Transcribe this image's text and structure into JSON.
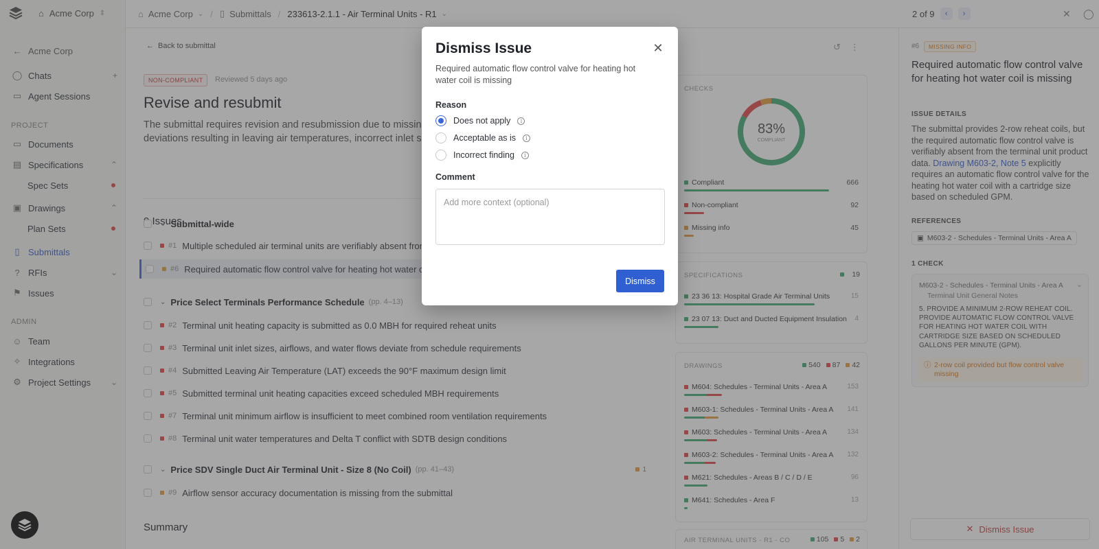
{
  "sidebar": {
    "org": "Acme Corp",
    "back_label": "Acme Corp",
    "chats": "Chats",
    "agent_sessions": "Agent Sessions",
    "project_section": "PROJECT",
    "documents": "Documents",
    "specifications": "Specifications",
    "spec_sets": "Spec Sets",
    "drawings": "Drawings",
    "plan_sets": "Plan Sets",
    "submittals": "Submittals",
    "rfis": "RFIs",
    "issues": "Issues",
    "admin_section": "ADMIN",
    "team": "Team",
    "integrations": "Integrations",
    "project_settings": "Project Settings"
  },
  "topbar": {
    "org": "Acme Corp",
    "submittals": "Submittals",
    "current": "233613-2.1.1 - Air Terminal Units - R1",
    "pager": "2 of 9"
  },
  "main": {
    "back": "Back to submittal",
    "status_badge": "NON-COMPLIANT",
    "reviewed": "Reviewed 5 days ago",
    "title": "Revise and resubmit",
    "summary": "The submittal requires revision and resubmission due to missing terminal units, widespread heating capacity deviations resulting in leaving air temperatures, incorrect inlet sizes, and missing flow",
    "issues_count": "9 Issues",
    "groups": {
      "g1": {
        "name": "Submittal-wide",
        "pages": ""
      },
      "g2": {
        "name": "Price Select Terminals Performance Schedule",
        "pages": "(pp. 4–13)"
      },
      "g3": {
        "name": "Price SDV Single Duct Air Terminal Unit - Size 8 (No Coil)",
        "pages": "(pp. 41–43)",
        "count": "1"
      }
    },
    "issues": [
      {
        "num": "#1",
        "text": "Multiple scheduled air terminal units are verifiably absent from",
        "color": "#e25050"
      },
      {
        "num": "#6",
        "text": "Required automatic flow control valve for heating hot water co",
        "color": "#e8a04a"
      },
      {
        "num": "#2",
        "text": "Terminal unit heating capacity is submitted as 0.0 MBH for required reheat units",
        "color": "#e25050"
      },
      {
        "num": "#3",
        "text": "Terminal unit inlet sizes, airflows, and water flows deviate from schedule requirements",
        "color": "#e25050"
      },
      {
        "num": "#4",
        "text": "Submitted Leaving Air Temperature (LAT) exceeds the 90°F maximum design limit",
        "color": "#e25050"
      },
      {
        "num": "#5",
        "text": "Submitted terminal unit heating capacities exceed scheduled MBH requirements",
        "color": "#e25050"
      },
      {
        "num": "#7",
        "text": "Terminal unit minimum airflow is insufficient to meet combined room ventilation requirements",
        "color": "#e25050"
      },
      {
        "num": "#8",
        "text": "Terminal unit water temperatures and Delta T conflict with SDTB design conditions",
        "color": "#e25050"
      },
      {
        "num": "#9",
        "text": "Airflow sensor accuracy documentation is missing from the submittal",
        "color": "#e8a04a"
      }
    ],
    "summary_heading": "Summary"
  },
  "checks": {
    "title": "CHECKS",
    "percent": "83%",
    "percent_value": 83,
    "percent_label": "COMPLIANT",
    "rows": [
      {
        "label": "Compliant",
        "value": "666",
        "color": "#4caf7a",
        "fraction": 0.83
      },
      {
        "label": "Non-compliant",
        "value": "92",
        "color": "#e25050",
        "fraction": 0.115
      },
      {
        "label": "Missing info",
        "value": "45",
        "color": "#e8a04a",
        "fraction": 0.056
      }
    ]
  },
  "specifications": {
    "title": "SPECIFICATIONS",
    "count": "19",
    "rows": [
      {
        "label": "23 36 13: Hospital Grade Air Terminal Units",
        "value": "15"
      },
      {
        "label": "23 07 13: Duct and Ducted Equipment Insulation",
        "value": "4"
      }
    ]
  },
  "drawings": {
    "title": "DRAWINGS",
    "counts": [
      "540",
      "87",
      "42"
    ],
    "rows": [
      {
        "label": "M604: Schedules - Terminal Units - Area A",
        "value": "153"
      },
      {
        "label": "M603-1: Schedules - Terminal Units - Area A",
        "value": "141"
      },
      {
        "label": "M603: Schedules - Terminal Units - Area A",
        "value": "134"
      },
      {
        "label": "M603-2: Schedules - Terminal Units - Area A",
        "value": "132"
      },
      {
        "label": "M621: Schedules - Areas B / C / D / E",
        "value": "96"
      },
      {
        "label": "M641: Schedules - Area F",
        "value": "13"
      }
    ],
    "next_title": "AIR TERMINAL UNITS - R1 - CO",
    "next_counts": [
      "105",
      "5",
      "2"
    ]
  },
  "detail": {
    "num": "#6",
    "badge": "MISSING INFO",
    "title": "Required automatic flow control valve for heating hot water coil is missing",
    "issue_details_label": "ISSUE DETAILS",
    "body_1": "The submittal provides 2-row reheat coils, but the required automatic flow control valve is verifiably absent from the terminal unit product data. ",
    "body_link": "Drawing M603-2, Note 5",
    "body_2": " explicitly requires an automatic flow control valve for the heating hot water coil with a cartridge size based on scheduled GPM.",
    "references_label": "REFERENCES",
    "reference": "M603-2 - Schedules - Terminal Units - Area A",
    "check_label": "1 CHECK",
    "check_source": "M603-2 - Schedules - Terminal Units - Area A",
    "check_sub": "Terminal Unit General Notes",
    "check_quote": "5. PROVIDE A MINIMUM 2-ROW REHEAT COIL. PROVIDE AUTOMATIC FLOW CONTROL VALVE FOR HEATING HOT WATER COIL WITH CARTRIDGE SIZE BASED ON SCHEDULED GALLONS PER MINUTE (GPM).",
    "check_note": "2-row coil provided but flow control valve missing",
    "dismiss_button": "Dismiss Issue"
  },
  "modal": {
    "title": "Dismiss Issue",
    "description": "Required automatic flow control valve for heating hot water coil is missing",
    "reason_label": "Reason",
    "options": [
      "Does not apply",
      "Acceptable as is",
      "Incorrect finding"
    ],
    "selected": "Does not apply",
    "comment_label": "Comment",
    "comment_placeholder": "Add more context (optional)",
    "comment_value": "",
    "submit": "Dismiss"
  },
  "colors": {
    "accent": "#2f5fd0",
    "compliant": "#4caf7a",
    "noncompliant": "#e25050",
    "missing": "#e8a04a"
  }
}
